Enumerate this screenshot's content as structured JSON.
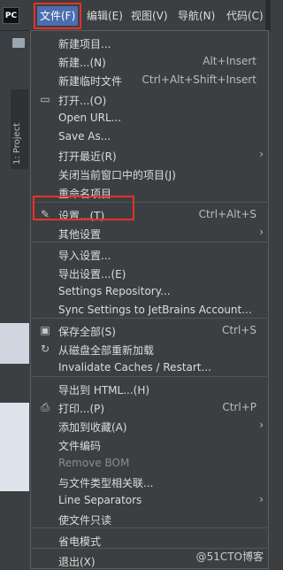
{
  "menubar": {
    "logo": "PC",
    "menus": [
      {
        "label": "文件(F)"
      },
      {
        "label": "编辑(E)"
      },
      {
        "label": "视图(V)"
      },
      {
        "label": "导航(N)"
      },
      {
        "label": "代码(C)"
      }
    ]
  },
  "sidebar": {
    "project_tab": "1: Project"
  },
  "file_menu": {
    "items": [
      {
        "label": "新建项目...",
        "shortcut": "",
        "icon": "",
        "submenu": false
      },
      {
        "label": "新建...(N)",
        "shortcut": "Alt+Insert",
        "icon": "",
        "submenu": false
      },
      {
        "label": "新建临时文件",
        "shortcut": "Ctrl+Alt+Shift+Insert",
        "icon": "",
        "submenu": false
      },
      {
        "label": "打开...(O)",
        "shortcut": "",
        "icon": "folder-icon",
        "submenu": false
      },
      {
        "label": "Open URL...",
        "shortcut": "",
        "icon": "",
        "submenu": false
      },
      {
        "label": "Save As...",
        "shortcut": "",
        "icon": "",
        "submenu": false
      },
      {
        "label": "打开最近(R)",
        "shortcut": "",
        "icon": "",
        "submenu": true
      },
      {
        "label": "关闭当前窗口中的项目(J)",
        "shortcut": "",
        "icon": "",
        "submenu": false
      },
      {
        "label": "重命名项目...",
        "shortcut": "",
        "icon": "",
        "submenu": false
      },
      {
        "label": "设置...(T)",
        "shortcut": "Ctrl+Alt+S",
        "icon": "wrench-icon",
        "submenu": false
      },
      {
        "label": "其他设置",
        "shortcut": "",
        "icon": "",
        "submenu": true
      },
      {
        "label": "导入设置...",
        "shortcut": "",
        "icon": "",
        "submenu": false
      },
      {
        "label": "导出设置...(E)",
        "shortcut": "",
        "icon": "",
        "submenu": false
      },
      {
        "label": "Settings Repository...",
        "shortcut": "",
        "icon": "",
        "submenu": false
      },
      {
        "label": "Sync Settings to JetBrains Account...",
        "shortcut": "",
        "icon": "",
        "submenu": false
      },
      {
        "label": "保存全部(S)",
        "shortcut": "Ctrl+S",
        "icon": "save-icon",
        "submenu": false
      },
      {
        "label": "从磁盘全部重新加载",
        "shortcut": "",
        "icon": "reload-icon",
        "submenu": false
      },
      {
        "label": "Invalidate Caches / Restart...",
        "shortcut": "",
        "icon": "",
        "submenu": false
      },
      {
        "label": "导出到 HTML...(H)",
        "shortcut": "",
        "icon": "",
        "submenu": false
      },
      {
        "label": "打印...(P)",
        "shortcut": "Ctrl+P",
        "icon": "print-icon",
        "submenu": false
      },
      {
        "label": "添加到收藏(A)",
        "shortcut": "",
        "icon": "",
        "submenu": true
      },
      {
        "label": "文件编码",
        "shortcut": "",
        "icon": "",
        "submenu": false
      },
      {
        "label": "Remove BOM",
        "shortcut": "",
        "icon": "",
        "submenu": false,
        "disabled": true
      },
      {
        "label": "与文件类型相关联...",
        "shortcut": "",
        "icon": "",
        "submenu": false
      },
      {
        "label": "Line Separators",
        "shortcut": "",
        "icon": "",
        "submenu": true
      },
      {
        "label": "使文件只读",
        "shortcut": "",
        "icon": "",
        "submenu": false
      },
      {
        "label": "省电模式",
        "shortcut": "",
        "icon": "",
        "submenu": false
      },
      {
        "label": "退出(X)",
        "shortcut": "",
        "icon": "",
        "submenu": false
      }
    ]
  },
  "watermark": "@51CTO博客"
}
